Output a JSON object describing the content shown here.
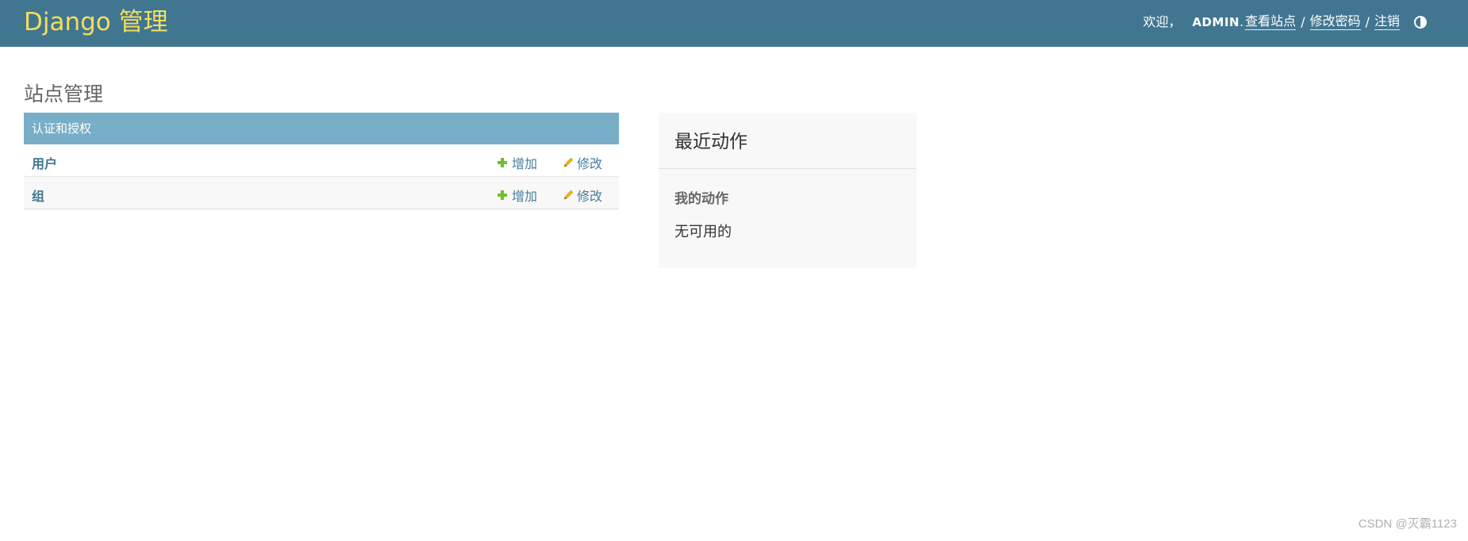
{
  "header": {
    "brand": "Django 管理",
    "welcome": "欢迎，",
    "username": "ADMIN",
    "dot": ".",
    "view_site": "查看站点",
    "separator": "/",
    "change_password": "修改密码",
    "logout": "注销",
    "theme_toggle_icon": "half-circle-icon"
  },
  "page": {
    "title": "站点管理"
  },
  "app_module": {
    "caption": "认证和授权",
    "models": [
      {
        "name": "用户",
        "add_label": "增加",
        "change_label": "修改"
      },
      {
        "name": "组",
        "add_label": "增加",
        "change_label": "修改"
      }
    ]
  },
  "recent_actions": {
    "title": "最近动作",
    "subtitle": "我的动作",
    "empty_text": "无可用的"
  },
  "watermark": "CSDN @灭霸1123",
  "colors": {
    "header_bg": "#417690",
    "brand": "#f5dd5d",
    "caption_bg": "#79aec8",
    "link": "#447e9b",
    "add_icon": "#70bf2b",
    "change_icon": "#efb80b"
  }
}
